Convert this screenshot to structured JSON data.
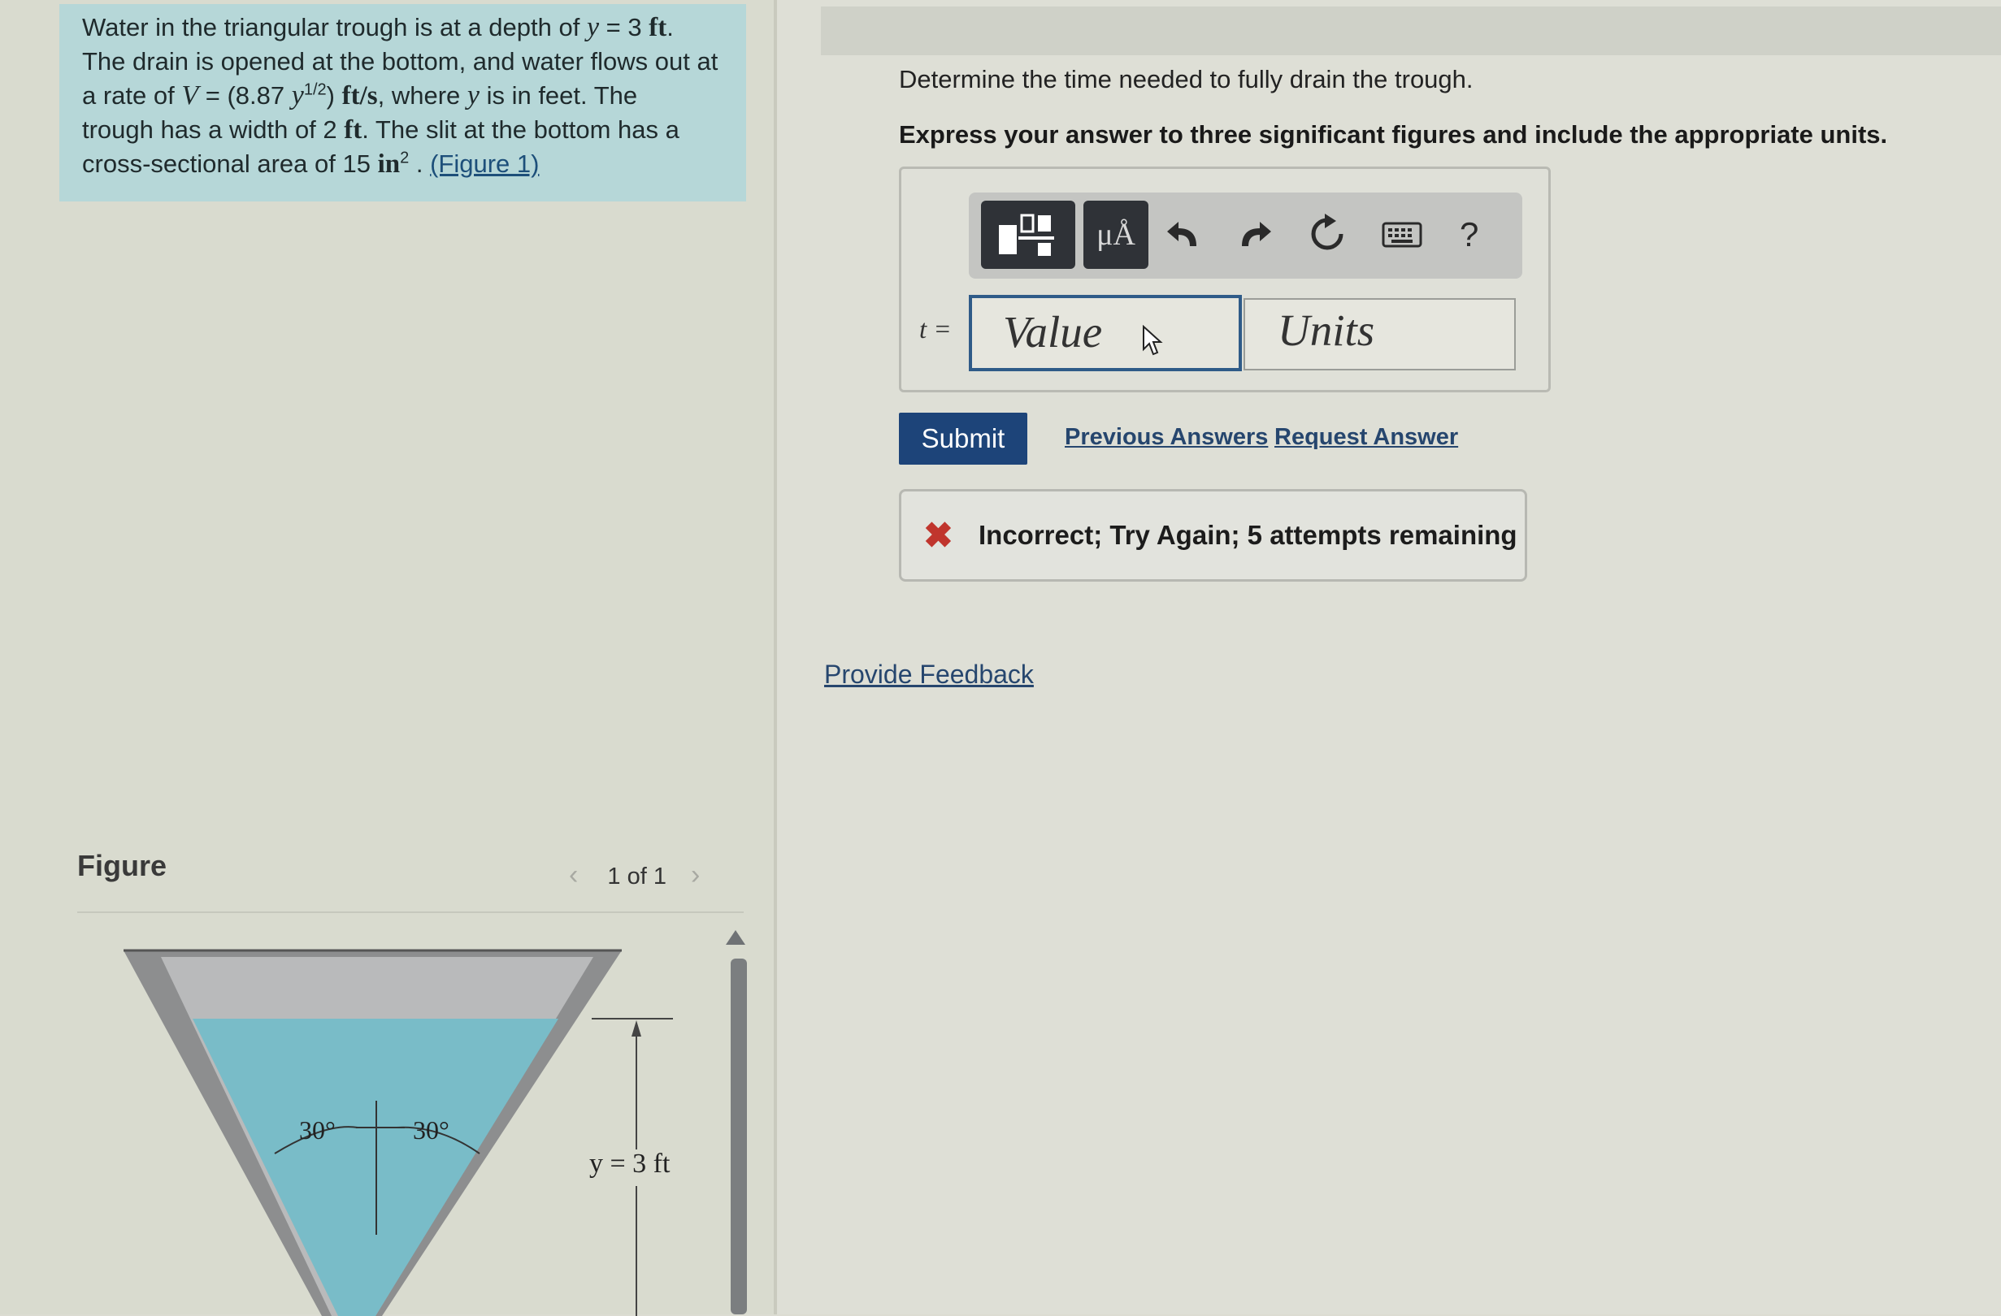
{
  "problem": {
    "line1_text": "Water in the triangular trough is at a depth of ",
    "line1_math": "y",
    "line1_eq": " = 3 ",
    "line1_unit": "ft",
    "line1_end": ".",
    "line2": "The drain is opened at the bottom, and water flows out at",
    "line3_pre": "a rate of ",
    "line3_V": "V",
    "line3_eq": " = (8.87 ",
    "line3_y": "y",
    "line3_exp": "1/2",
    "line3_close": ") ",
    "line3_unit": "ft/s",
    "line3_post": ", where ",
    "line3_y2": "y",
    "line3_end": " is in feet. The",
    "line4_pre": "trough has a width of 2 ",
    "line4_unit": "ft",
    "line4_end": ". The slit at the bottom has a",
    "line5_pre": "cross-sectional area of 15  ",
    "line5_unit": "in",
    "line5_exp": "2",
    "line5_dot": " . ",
    "figure_link": "(Figure 1)"
  },
  "figure": {
    "title": "Figure",
    "nav_prev": "‹",
    "nav_text": "1 of 1",
    "nav_next": "›",
    "angle_left": "30°",
    "angle_right": "30°",
    "depth_label": "y = 3 ft"
  },
  "question": {
    "prompt": "Determine the time needed to fully drain the trough.",
    "instruction": "Express your answer to three significant figures and include the appropriate units."
  },
  "toolbar": {
    "units_button": "μÅ",
    "undo_icon": "undo-icon",
    "redo_icon": "redo-icon",
    "reset_icon": "reset-icon",
    "keyboard_icon": "keyboard-icon",
    "help": "?"
  },
  "answer": {
    "variable": "t =",
    "value_placeholder": "Value",
    "units_placeholder": "Units"
  },
  "actions": {
    "submit": "Submit",
    "previous_answers": "Previous Answers",
    "request_answer": "Request Answer"
  },
  "feedback": {
    "icon": "✖",
    "message": "Incorrect; Try Again; 5 attempts remaining"
  },
  "footer": {
    "provide_feedback": "Provide Feedback"
  },
  "colors": {
    "problem_bg": "#b6d7d8",
    "submit_bg": "#1d4479",
    "error_red": "#c0352d",
    "water": "#79bcc8"
  }
}
